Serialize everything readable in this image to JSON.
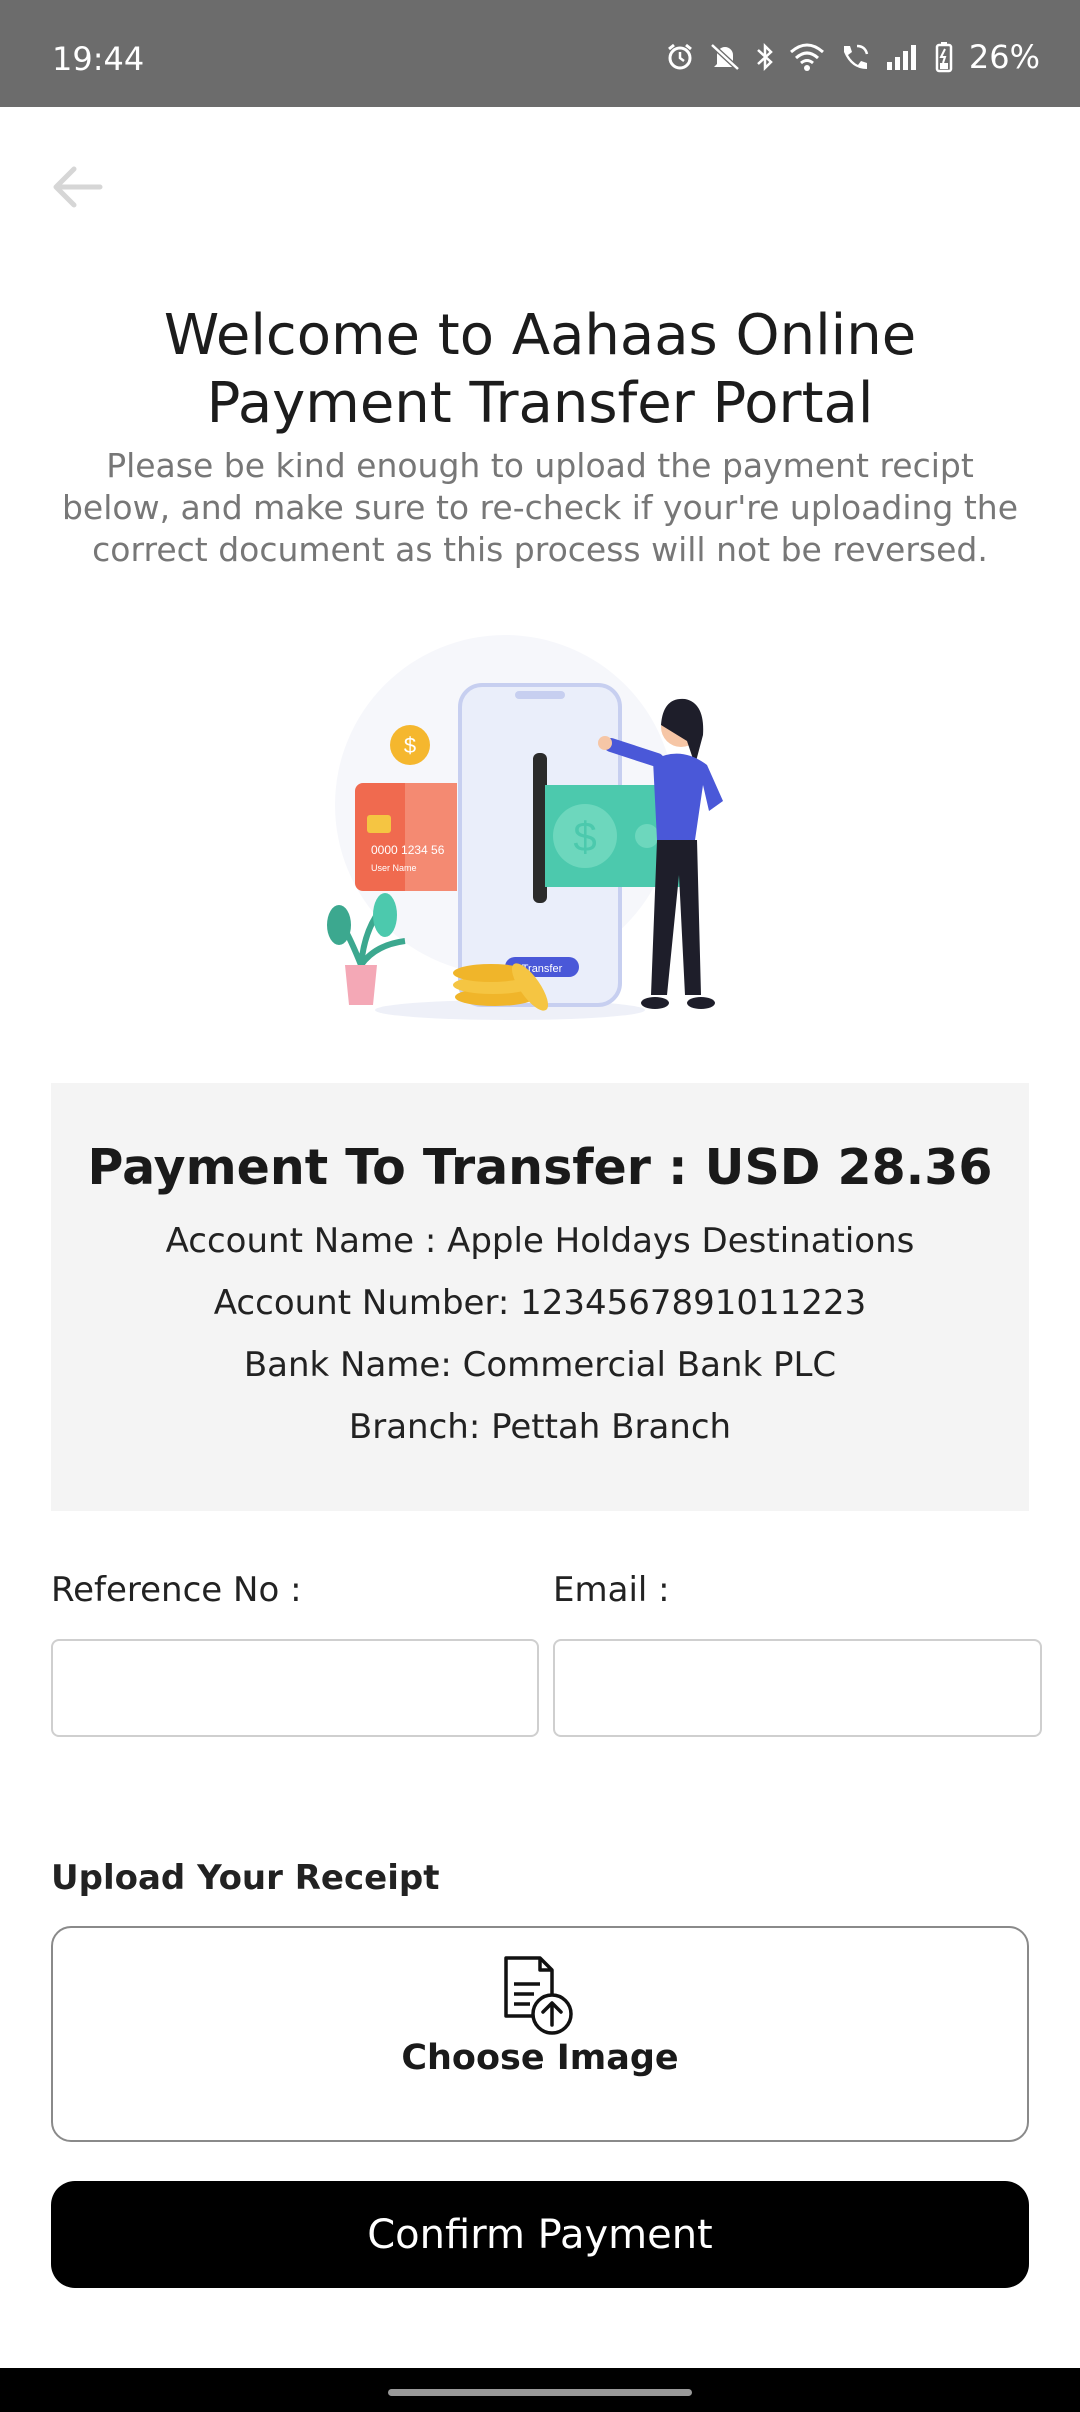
{
  "status_bar": {
    "time": "19:44",
    "battery": "26%",
    "icons": [
      "alarm-icon",
      "mute-icon",
      "bluetooth-icon",
      "wifi-icon",
      "wifi-calling-icon",
      "signal-icon",
      "battery-icon"
    ]
  },
  "header": {
    "back_icon": "arrow-left-icon",
    "title": "Welcome to Aahaas Online Payment Transfer Portal",
    "subtitle": "Please be kind enough to upload the payment recipt below, and make sure to re-check if your're uploading the correct document as this process will not be reversed."
  },
  "illustration": {
    "card_number": "0000 1234 56",
    "card_name": "User Name",
    "phone_button": "Transfer"
  },
  "payment": {
    "amount_line": "Payment To Transfer : USD 28.36",
    "account_name": "Account Name : Apple Holdays Destinations",
    "account_number": "Account Number: 1234567891011223",
    "bank_name": "Bank Name: Commercial Bank PLC",
    "branch": "Branch: Pettah Branch"
  },
  "form": {
    "reference_label": "Reference No :",
    "reference_value": "",
    "email_label": "Email :",
    "email_value": "",
    "upload_label": "Upload Your Receipt",
    "choose_image": "Choose Image",
    "confirm_button": "Confirm Payment"
  },
  "colors": {
    "status_bar": "#6c6c6c",
    "card_bg": "#f4f4f4",
    "button": "#000000",
    "teal": "#4cc9ad",
    "coral": "#f06a4f",
    "purple": "#4a58d8"
  }
}
